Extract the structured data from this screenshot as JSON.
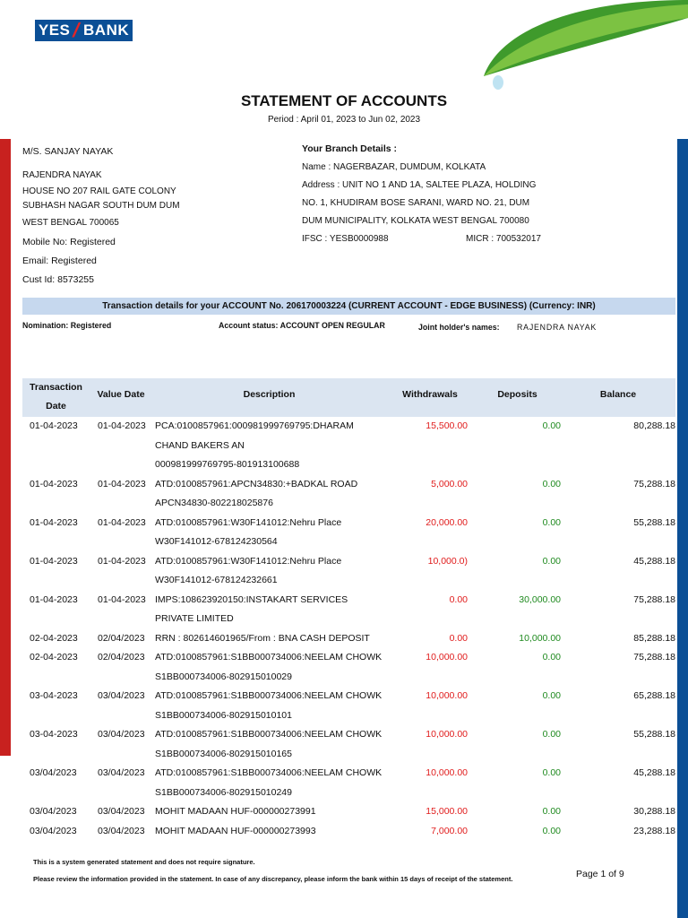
{
  "bank": {
    "logo_text": "YES BANK",
    "logo_left": "YES",
    "logo_right": "BANK"
  },
  "title": "STATEMENT OF ACCOUNTS",
  "period": "Period : April 01, 2023 to Jun 02, 2023",
  "customer": {
    "name": "M/S. SANJAY NAYAK",
    "line1": "RAJENDRA NAYAK",
    "line2": "HOUSE NO 207 RAIL GATE COLONY",
    "line3": "SUBHASH NAGAR SOUTH DUM DUM",
    "line4": "WEST BENGAL 700065",
    "mobile": "Mobile No: Registered",
    "email": "Email: Registered",
    "cust_id": "Cust Id: 8573255"
  },
  "branch": {
    "heading": "Your Branch Details :",
    "name": "Name : NAGERBAZAR, DUMDUM, KOLKATA",
    "addr1": "Address : UNIT NO 1 AND 1A, SALTEE PLAZA, HOLDING",
    "addr2": "NO. 1, KHUDIRAM BOSE SARANI, WARD NO. 21, DUM",
    "addr3": "DUM MUNICIPALITY, KOLKATA WEST BENGAL 700080",
    "ifsc": "IFSC : YESB0000988",
    "micr": "MICR : 700532017"
  },
  "account_bar": "Transaction details for your ACCOUNT No. 206170003224 (CURRENT ACCOUNT - EDGE BUSINESS) (Currency: INR)",
  "meta": {
    "nomination": "Nomination: Registered",
    "status": "Account status: ACCOUNT OPEN REGULAR",
    "joint_label": "Joint holder's names:",
    "joint_value": "RAJENDRA NAYAK"
  },
  "table": {
    "headers": {
      "txn1": "Transaction",
      "txn2": "Date",
      "value_date": "Value Date",
      "description": "Description",
      "withdrawals": "Withdrawals",
      "deposits": "Deposits",
      "balance": "Balance"
    },
    "rows": [
      {
        "date": "01-04-2023",
        "value_date": "01-04-2023",
        "desc": [
          "PCA:0100857961:000981999769795:DHARAM",
          "CHAND BAKERS AN",
          "000981999769795-801913100688"
        ],
        "wd": "15,500.00",
        "dp": "0.00",
        "bal": "80,288.18"
      },
      {
        "date": "01-04-2023",
        "value_date": "01-04-2023",
        "desc": [
          "ATD:0100857961:APCN34830:+BADKAL ROAD",
          "APCN34830-802218025876"
        ],
        "wd": "5,000.00",
        "dp": "0.00",
        "bal": "75,288.18"
      },
      {
        "date": "01-04-2023",
        "value_date": "01-04-2023",
        "desc": [
          "ATD:0100857961:W30F141012:Nehru Place",
          "W30F141012-678124230564"
        ],
        "wd": "20,000.00",
        "dp": "0.00",
        "bal": "55,288.18"
      },
      {
        "date": "01-04-2023",
        "value_date": "01-04-2023",
        "desc": [
          "ATD:0100857961:W30F141012:Nehru Place",
          "W30F141012-678124232661"
        ],
        "wd": "10,000.0)",
        "dp": "0.00",
        "bal": "45,288.18"
      },
      {
        "date": "01-04-2023",
        "value_date": "01-04-2023",
        "desc": [
          "IMPS:108623920150:INSTAKART SERVICES",
          "PRIVATE LIMITED"
        ],
        "wd": "0.00",
        "dp": "30,000.00",
        "bal": "75,288.18"
      },
      {
        "date": "02-04-2023",
        "value_date": "02/04/2023",
        "desc": [
          "RRN : 802614601965/From : BNA CASH DEPOSIT"
        ],
        "wd": "0.00",
        "dp": "10,000.00",
        "bal": "85,288.18"
      },
      {
        "date": "02-04-2023",
        "value_date": "02/04/2023",
        "desc": [
          "ATD:0100857961:S1BB000734006:NEELAM CHOWK",
          "S1BB000734006-802915010029"
        ],
        "wd": "10,000.00",
        "dp": "0.00",
        "bal": "75,288.18"
      },
      {
        "date": "03-04-2023",
        "value_date": "03/04/2023",
        "desc": [
          "ATD:0100857961:S1BB000734006:NEELAM CHOWK",
          "S1BB000734006-802915010101"
        ],
        "wd": "10,000.00",
        "dp": "0.00",
        "bal": "65,288.18"
      },
      {
        "date": "03-04-2023",
        "value_date": "03/04/2023",
        "desc": [
          "ATD:0100857961:S1BB000734006:NEELAM CHOWK",
          "S1BB000734006-802915010165"
        ],
        "wd": "10,000.00",
        "dp": "0.00",
        "bal": "55,288.18"
      },
      {
        "date": "03/04/2023",
        "value_date": "03/04/2023",
        "desc": [
          "ATD:0100857961:S1BB000734006:NEELAM CHOWK",
          "S1BB000734006-802915010249"
        ],
        "wd": "10,000.00",
        "dp": "0.00",
        "bal": "45,288.18"
      },
      {
        "date": "03/04/2023",
        "value_date": "03/04/2023",
        "desc": [
          "MOHIT MADAAN HUF-000000273991"
        ],
        "wd": "15,000.00",
        "dp": "0.00",
        "bal": "30,288.18"
      },
      {
        "date": "03/04/2023",
        "value_date": "03/04/2023",
        "desc": [
          "MOHIT MADAAN HUF-000000273993"
        ],
        "wd": "7,000.00",
        "dp": "0.00",
        "bal": "23,288.18"
      }
    ]
  },
  "footer": {
    "line1": "This is a system generated statement and does not require signature.",
    "line2": "Please review the information provided in the statement. In case of any discrepancy, please inform the bank within 15 days of receipt of the statement.",
    "page": "Page 1 of 9"
  }
}
